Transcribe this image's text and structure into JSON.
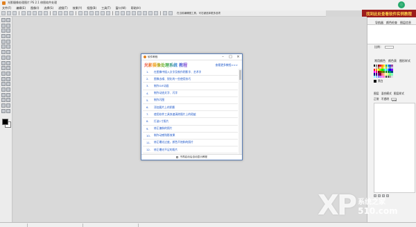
{
  "window": {
    "title": "光影摄像处理图片 PS 2.1 修图软件处理"
  },
  "menu": [
    "文件(F)",
    "编辑(E)",
    "图像(I)",
    "选择(S)",
    "滤镜(T)",
    "效果(Y)",
    "抠图(B)",
    "工具(T)",
    "窗口(W)",
    "帮助(H)"
  ],
  "toolbar": {
    "center_text": "在当前编辑图工具，可右键选择更多选项"
  },
  "promo": {
    "text": "找到此处查看软件实例教程"
  },
  "badge": {
    "logo": "ⓘ",
    "text": ""
  },
  "right_panel": {
    "tabs": [
      "导航器",
      "颜色检查",
      "图层信息"
    ],
    "zoom_label": "比例：",
    "palette_tabs": [
      "常用颜色",
      "颜色表",
      "图形样式"
    ],
    "bw_label": "黑白",
    "layers_tabs": [
      "图层",
      "混合模式",
      "图层样式"
    ],
    "layers_mode": "正常",
    "layers_opacity_label": "不透明",
    "layers_opacity": "100"
  },
  "palette_colors": [
    "#000000",
    "#7f7f7f",
    "#880015",
    "#ed1c24",
    "#ff7f27",
    "#fff200",
    "#22b14c",
    "#00a2e8",
    "#3f48cc",
    "#a349a4",
    "#ffffff",
    "#c3c3c3",
    "#b97a57",
    "#ffaec9",
    "#ffc90e",
    "#efe4b0",
    "#b5e61d",
    "#99d9ea",
    "#7092be",
    "#c8bfe7",
    "#ff0000",
    "#ff8000",
    "#ffff00",
    "#80ff00",
    "#00ff00",
    "#00ff80",
    "#00ffff",
    "#0080ff",
    "#0000ff",
    "#8000ff",
    "#ff00ff",
    "#ff0080",
    "#800000",
    "#804000",
    "#808000",
    "#408000",
    "#008000",
    "#008040",
    "#008080",
    "#004080",
    "#000080",
    "#400080",
    "#800080",
    "#800040",
    "#ff8080",
    "#ffc080",
    "#ffff80",
    "#c0ff80",
    "#80ff80",
    "#80ffc0",
    "#80ffff",
    "#80c0ff",
    "#8080ff",
    "#c080ff",
    "#ff80ff",
    "#ff80c0",
    "#404040",
    "#606060",
    "#a0a0a0",
    "#e0e0e0"
  ],
  "popup": {
    "title": "软件教程",
    "heading": "光影摄像处理系统 教程",
    "more_link": "查看更多教程>>>",
    "items": [
      {
        "num": "1.",
        "text": "在图像中插入文字及制作阴影字、艺术字"
      },
      {
        "num": "2.",
        "text": "图像去噪、锐化的一些使用技巧"
      },
      {
        "num": "3.",
        "text": "制作GIF动画"
      },
      {
        "num": "4.",
        "text": "制作动态文字、闪字"
      },
      {
        "num": "5.",
        "text": "制作闪图"
      },
      {
        "num": "6.",
        "text": "添加图片上的阴影"
      },
      {
        "num": "7.",
        "text": "使用软件工具快速清除图片上的瑕疵"
      },
      {
        "num": "8.",
        "text": "打造1寸照片"
      },
      {
        "num": "9.",
        "text": "修正偏斜的照片"
      },
      {
        "num": "10.",
        "text": "制作动感残影效果"
      },
      {
        "num": "11.",
        "text": "修正曝光过度，颜色不饱和的照片"
      },
      {
        "num": "12.",
        "text": "修正曝光不足的照片"
      }
    ],
    "footer": "不再启动后自动显示教程"
  },
  "watermark": {
    "big": "XP",
    "cn": "系统之家",
    "num": "510.com"
  },
  "colors": {
    "popup_border": "#5a7fb8",
    "link": "#1a55c8",
    "promo_bg": "#9c1c1c",
    "promo_text": "#ffd34d"
  }
}
